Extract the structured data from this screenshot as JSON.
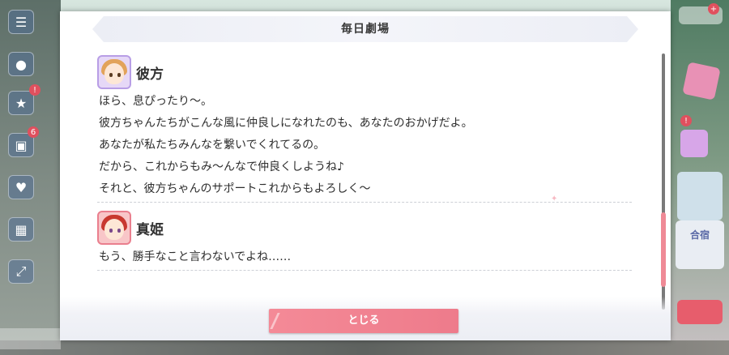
{
  "dialog": {
    "title": "毎日劇場",
    "close_label": "とじる"
  },
  "entries": [
    {
      "speaker": "彼方",
      "lines": [
        "ほら、息ぴったり〜。",
        "彼方ちゃんたちがこんな風に仲良しになれたのも、あなたのおかげだよ。",
        "あなたが私たちみんなを繋いでくれてるの。",
        "だから、これからもみ〜んなで仲良くしようね♪",
        "それと、彼方ちゃんのサポートこれからもよろしく〜"
      ]
    },
    {
      "speaker": "真姫",
      "lines": [
        "もう、勝手なこと言わないでよね……"
      ]
    }
  ],
  "hud": {
    "badges": [
      "!",
      "6",
      "!"
    ],
    "right_label": "合宿"
  },
  "colors": {
    "accent": "#ef8a96",
    "title_bg": "#eceef5",
    "text": "#2e2e2e"
  }
}
